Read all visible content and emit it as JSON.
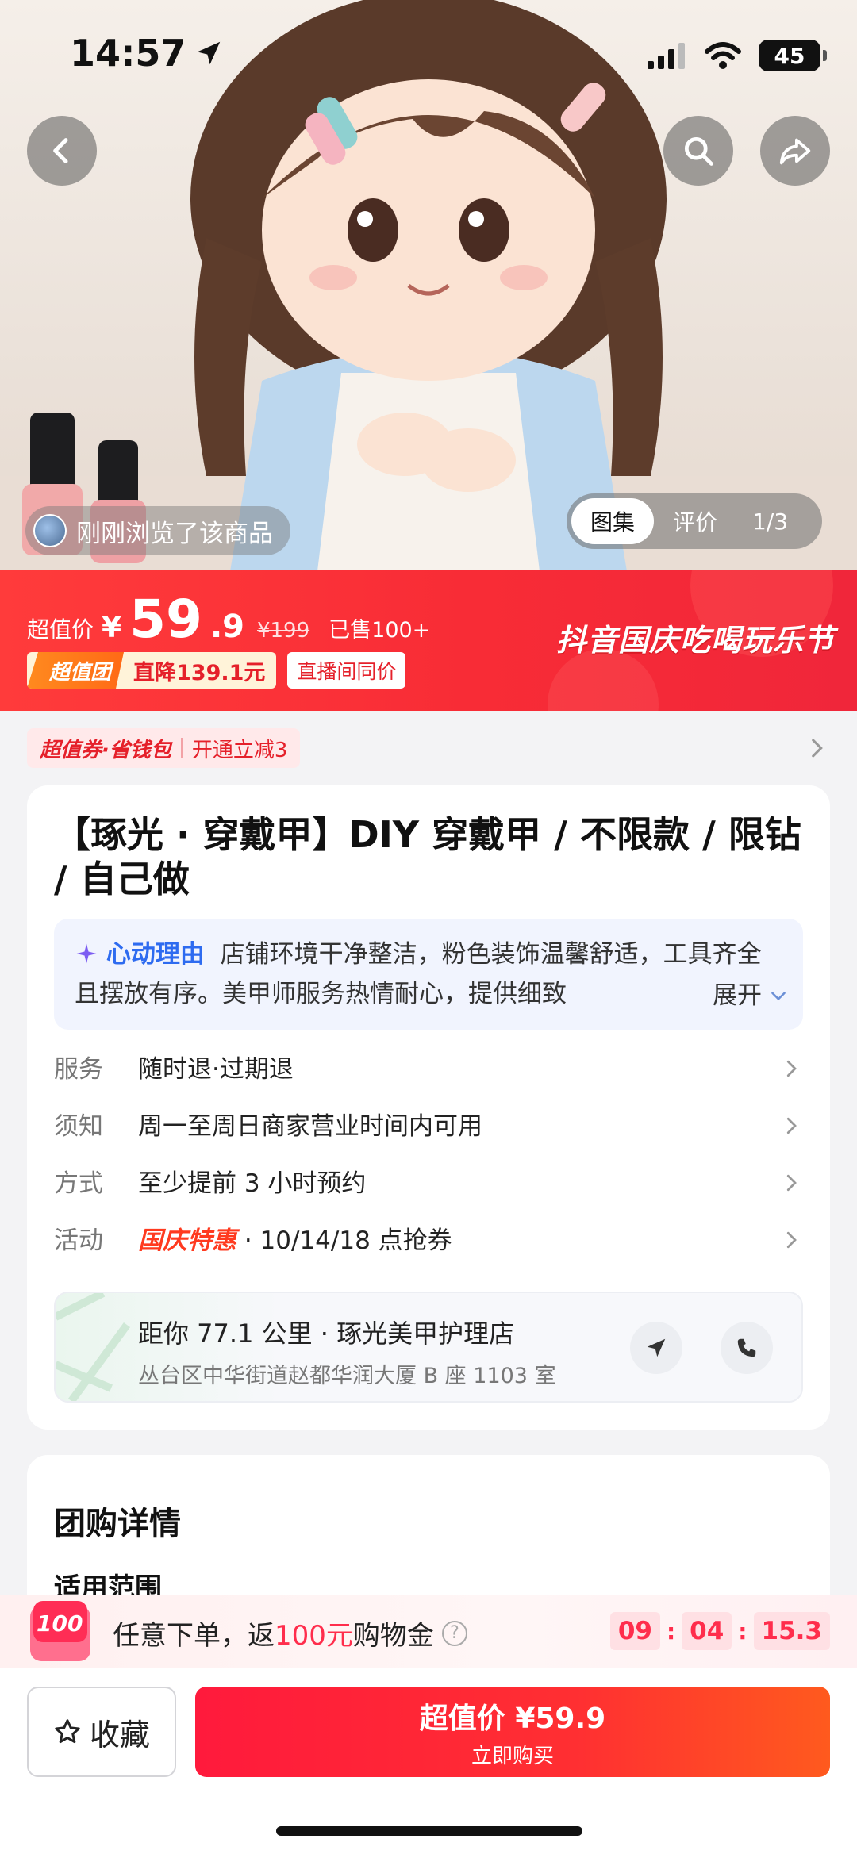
{
  "status_bar": {
    "time": "14:57",
    "battery": "45"
  },
  "hero": {
    "browsed_text": "刚刚浏览了该商品",
    "tabs": [
      "图集",
      "评价"
    ],
    "index": "1/3",
    "overlay_title": "【琢光 · 穿戴甲】"
  },
  "price": {
    "label": "超值价",
    "currency": "¥",
    "integer": "59",
    "decimal": ".9",
    "original": "¥199",
    "sold": "已售100+",
    "group_badge": "超值团",
    "discount": "直降139.1元",
    "live_tag": "直播间同价",
    "festival": "抖音国庆吃喝玩乐节"
  },
  "coupon": {
    "name": "超值券·省钱包",
    "action": "开通立减3"
  },
  "product": {
    "title": "【琢光 · 穿戴甲】DIY 穿戴甲 / 不限款 / 限钻 / 自己做",
    "reason_label": "心动理由",
    "reason_text": "店铺环境干净整洁，粉色装饰温馨舒适，工具齐全且摆放有序。美甲师服务热情耐心，提供细致",
    "expand": "展开"
  },
  "info": [
    {
      "key": "服务",
      "value": "随时退·过期退"
    },
    {
      "key": "须知",
      "value": "周一至周日商家营业时间内可用"
    },
    {
      "key": "方式",
      "value": "至少提前 3 小时预约"
    },
    {
      "key": "活动",
      "highlight": "国庆特惠",
      "value": " · 10/14/18 点抢券"
    }
  ],
  "shop": {
    "distance": "距你 77.1 公里 · 琢光美甲护理店",
    "address": "丛台区中华街道赵都华润大厦 B 座 1103 室"
  },
  "details": {
    "heading": "团购详情",
    "sub": "适用范围"
  },
  "promo": {
    "badge": "100",
    "text_a": "任意下单，返",
    "text_red": "100元",
    "text_b": "购物金",
    "timer": [
      "09",
      "04",
      "15.3"
    ]
  },
  "bottom": {
    "fav_label": "收藏",
    "buy_line1": "超值价 ¥59.9",
    "buy_line2": "立即购买"
  },
  "colors": {
    "accent_red": "#f82c36",
    "link_blue": "#2e6bf0"
  }
}
